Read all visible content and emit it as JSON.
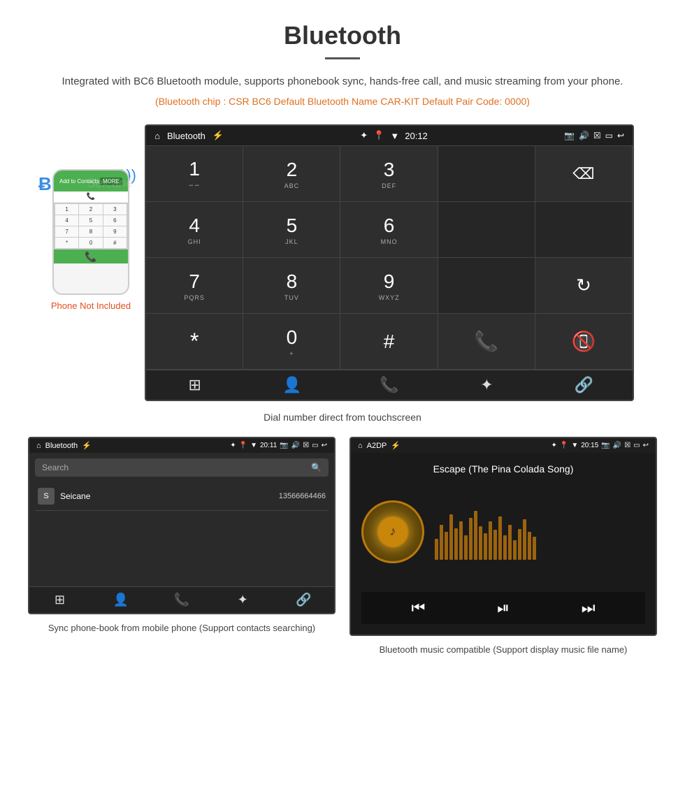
{
  "page": {
    "title": "Bluetooth",
    "description": "Integrated with BC6 Bluetooth module, supports phonebook sync, hands-free call, and music streaming from your phone.",
    "specs": "(Bluetooth chip : CSR BC6     Default Bluetooth Name CAR-KIT     Default Pair Code: 0000)",
    "main_caption": "Dial number direct from touchscreen",
    "bottom_left_caption": "Sync phone-book from mobile phone\n(Support contacts searching)",
    "bottom_right_caption": "Bluetooth music compatible\n(Support display music file name)",
    "phone_not_included": "Phone Not Included"
  },
  "statusbar_main": {
    "home_icon": "⌂",
    "title": "Bluetooth",
    "usb_icon": "⚡",
    "bt_icon": "✦",
    "location_icon": "⦿",
    "signal_icon": "▾",
    "time": "20:12",
    "camera_icon": "📷",
    "volume_icon": "🔊",
    "x_icon": "✕",
    "window_icon": "▭",
    "back_icon": "↩"
  },
  "dialpad": {
    "keys": [
      {
        "num": "1",
        "sub": "∽∽"
      },
      {
        "num": "2",
        "sub": "ABC"
      },
      {
        "num": "3",
        "sub": "DEF"
      },
      {
        "num": "empty",
        "sub": ""
      },
      {
        "num": "⌫",
        "sub": ""
      },
      {
        "num": "4",
        "sub": "GHI"
      },
      {
        "num": "5",
        "sub": "JKL"
      },
      {
        "num": "6",
        "sub": "MNO"
      },
      {
        "num": "empty",
        "sub": ""
      },
      {
        "num": "empty",
        "sub": ""
      },
      {
        "num": "7",
        "sub": "PQRS"
      },
      {
        "num": "8",
        "sub": "TUV"
      },
      {
        "num": "9",
        "sub": "WXYZ"
      },
      {
        "num": "empty",
        "sub": ""
      },
      {
        "num": "↻",
        "sub": ""
      },
      {
        "num": "*",
        "sub": ""
      },
      {
        "num": "0+",
        "sub": ""
      },
      {
        "num": "#",
        "sub": ""
      },
      {
        "num": "call",
        "sub": ""
      },
      {
        "num": "endcall",
        "sub": ""
      }
    ],
    "bottom_icons": [
      "⊞",
      "👤",
      "📞",
      "✦",
      "🔗"
    ]
  },
  "phonebook": {
    "statusbar_title": "Bluetooth",
    "statusbar_time": "20:11",
    "search_placeholder": "Search",
    "contact": {
      "initial": "S",
      "name": "Seicane",
      "number": "13566664466"
    },
    "bottom_icons": [
      "⊞",
      "👤",
      "📞",
      "✦",
      "🔗"
    ]
  },
  "music": {
    "statusbar_title": "A2DP",
    "statusbar_time": "20:15",
    "song_title": "Escape (The Pina Colada Song)",
    "music_note": "♪",
    "controls": [
      "⏮",
      "⏯",
      "⏭"
    ]
  },
  "phone_mockup": {
    "dialer_keys": [
      "1",
      "2",
      "3",
      "4",
      "5",
      "6",
      "7",
      "8",
      "9",
      "*",
      "0",
      "#"
    ]
  }
}
